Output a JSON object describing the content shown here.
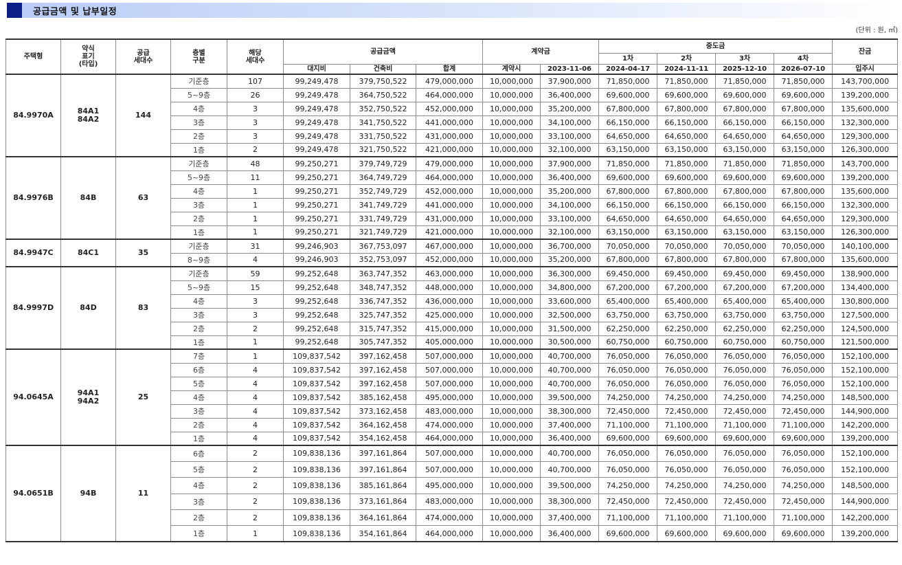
{
  "title": "공급금액 및 납부일정",
  "unit_note": "(단위 : 원, ㎡)",
  "headers": {
    "housing_type": "주택형",
    "abbrev": [
      "약식",
      "표기",
      "(타입)"
    ],
    "supply_units": [
      "공급",
      "세대수"
    ],
    "floor_group": [
      "층별",
      "구분"
    ],
    "applicable_units": [
      "해당",
      "세대수"
    ],
    "supply_amount": "공급금액",
    "land": "대지비",
    "building": "건축비",
    "total": "합계",
    "contract": "계약금",
    "contract_at": "계약시",
    "contract_date": "2023-11-06",
    "middle": "중도금",
    "mid1": "1차",
    "mid2": "2차",
    "mid3": "3차",
    "mid4": "4차",
    "mid1_date": "2024-04-17",
    "mid2_date": "2024-11-11",
    "mid3_date": "2025-12-10",
    "mid4_date": "2026-07-10",
    "balance": "잔금",
    "move_in": "입주시"
  },
  "groups": [
    {
      "type": "84.9970A",
      "abbrev": [
        "84A1",
        "84A2"
      ],
      "units": "144",
      "rows": [
        {
          "floor": "기준층",
          "count": "107",
          "land": "99,249,478",
          "building": "379,750,522",
          "total": "479,000,000",
          "c1": "10,000,000",
          "c2": "37,900,000",
          "m1": "71,850,000",
          "m2": "71,850,000",
          "m3": "71,850,000",
          "m4": "71,850,000",
          "bal": "143,700,000"
        },
        {
          "floor": "5~9층",
          "count": "26",
          "land": "99,249,478",
          "building": "364,750,522",
          "total": "464,000,000",
          "c1": "10,000,000",
          "c2": "36,400,000",
          "m1": "69,600,000",
          "m2": "69,600,000",
          "m3": "69,600,000",
          "m4": "69,600,000",
          "bal": "139,200,000"
        },
        {
          "floor": "4층",
          "count": "3",
          "land": "99,249,478",
          "building": "352,750,522",
          "total": "452,000,000",
          "c1": "10,000,000",
          "c2": "35,200,000",
          "m1": "67,800,000",
          "m2": "67,800,000",
          "m3": "67,800,000",
          "m4": "67,800,000",
          "bal": "135,600,000"
        },
        {
          "floor": "3층",
          "count": "3",
          "land": "99,249,478",
          "building": "341,750,522",
          "total": "441,000,000",
          "c1": "10,000,000",
          "c2": "34,100,000",
          "m1": "66,150,000",
          "m2": "66,150,000",
          "m3": "66,150,000",
          "m4": "66,150,000",
          "bal": "132,300,000"
        },
        {
          "floor": "2층",
          "count": "3",
          "land": "99,249,478",
          "building": "331,750,522",
          "total": "431,000,000",
          "c1": "10,000,000",
          "c2": "33,100,000",
          "m1": "64,650,000",
          "m2": "64,650,000",
          "m3": "64,650,000",
          "m4": "64,650,000",
          "bal": "129,300,000"
        },
        {
          "floor": "1층",
          "count": "2",
          "land": "99,249,478",
          "building": "321,750,522",
          "total": "421,000,000",
          "c1": "10,000,000",
          "c2": "32,100,000",
          "m1": "63,150,000",
          "m2": "63,150,000",
          "m3": "63,150,000",
          "m4": "63,150,000",
          "bal": "126,300,000"
        }
      ]
    },
    {
      "type": "84.9976B",
      "abbrev": [
        "84B"
      ],
      "units": "63",
      "rows": [
        {
          "floor": "기준층",
          "count": "48",
          "land": "99,250,271",
          "building": "379,749,729",
          "total": "479,000,000",
          "c1": "10,000,000",
          "c2": "37,900,000",
          "m1": "71,850,000",
          "m2": "71,850,000",
          "m3": "71,850,000",
          "m4": "71,850,000",
          "bal": "143,700,000"
        },
        {
          "floor": "5~9층",
          "count": "11",
          "land": "99,250,271",
          "building": "364,749,729",
          "total": "464,000,000",
          "c1": "10,000,000",
          "c2": "36,400,000",
          "m1": "69,600,000",
          "m2": "69,600,000",
          "m3": "69,600,000",
          "m4": "69,600,000",
          "bal": "139,200,000"
        },
        {
          "floor": "4층",
          "count": "1",
          "land": "99,250,271",
          "building": "352,749,729",
          "total": "452,000,000",
          "c1": "10,000,000",
          "c2": "35,200,000",
          "m1": "67,800,000",
          "m2": "67,800,000",
          "m3": "67,800,000",
          "m4": "67,800,000",
          "bal": "135,600,000"
        },
        {
          "floor": "3층",
          "count": "1",
          "land": "99,250,271",
          "building": "341,749,729",
          "total": "441,000,000",
          "c1": "10,000,000",
          "c2": "34,100,000",
          "m1": "66,150,000",
          "m2": "66,150,000",
          "m3": "66,150,000",
          "m4": "66,150,000",
          "bal": "132,300,000"
        },
        {
          "floor": "2층",
          "count": "1",
          "land": "99,250,271",
          "building": "331,749,729",
          "total": "431,000,000",
          "c1": "10,000,000",
          "c2": "33,100,000",
          "m1": "64,650,000",
          "m2": "64,650,000",
          "m3": "64,650,000",
          "m4": "64,650,000",
          "bal": "129,300,000"
        },
        {
          "floor": "1층",
          "count": "1",
          "land": "99,250,271",
          "building": "321,749,729",
          "total": "421,000,000",
          "c1": "10,000,000",
          "c2": "32,100,000",
          "m1": "63,150,000",
          "m2": "63,150,000",
          "m3": "63,150,000",
          "m4": "63,150,000",
          "bal": "126,300,000"
        }
      ]
    },
    {
      "type": "84.9947C",
      "abbrev": [
        "84C1"
      ],
      "units": "35",
      "rows": [
        {
          "floor": "기준층",
          "count": "31",
          "land": "99,246,903",
          "building": "367,753,097",
          "total": "467,000,000",
          "c1": "10,000,000",
          "c2": "36,700,000",
          "m1": "70,050,000",
          "m2": "70,050,000",
          "m3": "70,050,000",
          "m4": "70,050,000",
          "bal": "140,100,000"
        },
        {
          "floor": "8~9층",
          "count": "4",
          "land": "99,246,903",
          "building": "352,753,097",
          "total": "452,000,000",
          "c1": "10,000,000",
          "c2": "35,200,000",
          "m1": "67,800,000",
          "m2": "67,800,000",
          "m3": "67,800,000",
          "m4": "67,800,000",
          "bal": "135,600,000"
        }
      ]
    },
    {
      "type": "84.9997D",
      "abbrev": [
        "84D"
      ],
      "units": "83",
      "rows": [
        {
          "floor": "기준층",
          "count": "59",
          "land": "99,252,648",
          "building": "363,747,352",
          "total": "463,000,000",
          "c1": "10,000,000",
          "c2": "36,300,000",
          "m1": "69,450,000",
          "m2": "69,450,000",
          "m3": "69,450,000",
          "m4": "69,450,000",
          "bal": "138,900,000"
        },
        {
          "floor": "5~9층",
          "count": "15",
          "land": "99,252,648",
          "building": "348,747,352",
          "total": "448,000,000",
          "c1": "10,000,000",
          "c2": "34,800,000",
          "m1": "67,200,000",
          "m2": "67,200,000",
          "m3": "67,200,000",
          "m4": "67,200,000",
          "bal": "134,400,000"
        },
        {
          "floor": "4층",
          "count": "3",
          "land": "99,252,648",
          "building": "336,747,352",
          "total": "436,000,000",
          "c1": "10,000,000",
          "c2": "33,600,000",
          "m1": "65,400,000",
          "m2": "65,400,000",
          "m3": "65,400,000",
          "m4": "65,400,000",
          "bal": "130,800,000"
        },
        {
          "floor": "3층",
          "count": "3",
          "land": "99,252,648",
          "building": "325,747,352",
          "total": "425,000,000",
          "c1": "10,000,000",
          "c2": "32,500,000",
          "m1": "63,750,000",
          "m2": "63,750,000",
          "m3": "63,750,000",
          "m4": "63,750,000",
          "bal": "127,500,000"
        },
        {
          "floor": "2층",
          "count": "2",
          "land": "99,252,648",
          "building": "315,747,352",
          "total": "415,000,000",
          "c1": "10,000,000",
          "c2": "31,500,000",
          "m1": "62,250,000",
          "m2": "62,250,000",
          "m3": "62,250,000",
          "m4": "62,250,000",
          "bal": "124,500,000"
        },
        {
          "floor": "1층",
          "count": "1",
          "land": "99,252,648",
          "building": "305,747,352",
          "total": "405,000,000",
          "c1": "10,000,000",
          "c2": "30,500,000",
          "m1": "60,750,000",
          "m2": "60,750,000",
          "m3": "60,750,000",
          "m4": "60,750,000",
          "bal": "121,500,000"
        }
      ]
    },
    {
      "type": "94.0645A",
      "abbrev": [
        "94A1",
        "94A2"
      ],
      "units": "25",
      "rows": [
        {
          "floor": "7층",
          "count": "1",
          "land": "109,837,542",
          "building": "397,162,458",
          "total": "507,000,000",
          "c1": "10,000,000",
          "c2": "40,700,000",
          "m1": "76,050,000",
          "m2": "76,050,000",
          "m3": "76,050,000",
          "m4": "76,050,000",
          "bal": "152,100,000"
        },
        {
          "floor": "6층",
          "count": "4",
          "land": "109,837,542",
          "building": "397,162,458",
          "total": "507,000,000",
          "c1": "10,000,000",
          "c2": "40,700,000",
          "m1": "76,050,000",
          "m2": "76,050,000",
          "m3": "76,050,000",
          "m4": "76,050,000",
          "bal": "152,100,000"
        },
        {
          "floor": "5층",
          "count": "4",
          "land": "109,837,542",
          "building": "397,162,458",
          "total": "507,000,000",
          "c1": "10,000,000",
          "c2": "40,700,000",
          "m1": "76,050,000",
          "m2": "76,050,000",
          "m3": "76,050,000",
          "m4": "76,050,000",
          "bal": "152,100,000"
        },
        {
          "floor": "4층",
          "count": "4",
          "land": "109,837,542",
          "building": "385,162,458",
          "total": "495,000,000",
          "c1": "10,000,000",
          "c2": "39,500,000",
          "m1": "74,250,000",
          "m2": "74,250,000",
          "m3": "74,250,000",
          "m4": "74,250,000",
          "bal": "148,500,000"
        },
        {
          "floor": "3층",
          "count": "4",
          "land": "109,837,542",
          "building": "373,162,458",
          "total": "483,000,000",
          "c1": "10,000,000",
          "c2": "38,300,000",
          "m1": "72,450,000",
          "m2": "72,450,000",
          "m3": "72,450,000",
          "m4": "72,450,000",
          "bal": "144,900,000"
        },
        {
          "floor": "2층",
          "count": "4",
          "land": "109,837,542",
          "building": "364,162,458",
          "total": "474,000,000",
          "c1": "10,000,000",
          "c2": "37,400,000",
          "m1": "71,100,000",
          "m2": "71,100,000",
          "m3": "71,100,000",
          "m4": "71,100,000",
          "bal": "142,200,000"
        },
        {
          "floor": "1층",
          "count": "4",
          "land": "109,837,542",
          "building": "354,162,458",
          "total": "464,000,000",
          "c1": "10,000,000",
          "c2": "36,400,000",
          "m1": "69,600,000",
          "m2": "69,600,000",
          "m3": "69,600,000",
          "m4": "69,600,000",
          "bal": "139,200,000"
        }
      ]
    },
    {
      "type": "94.0651B",
      "abbrev": [
        "94B"
      ],
      "units": "11",
      "rows": [
        {
          "floor": "6층",
          "count": "2",
          "land": "109,838,136",
          "building": "397,161,864",
          "total": "507,000,000",
          "c1": "10,000,000",
          "c2": "40,700,000",
          "m1": "76,050,000",
          "m2": "76,050,000",
          "m3": "76,050,000",
          "m4": "76,050,000",
          "bal": "152,100,000"
        },
        {
          "floor": "5층",
          "count": "2",
          "land": "109,838,136",
          "building": "397,161,864",
          "total": "507,000,000",
          "c1": "10,000,000",
          "c2": "40,700,000",
          "m1": "76,050,000",
          "m2": "76,050,000",
          "m3": "76,050,000",
          "m4": "76,050,000",
          "bal": "152,100,000"
        },
        {
          "floor": "4층",
          "count": "2",
          "land": "109,838,136",
          "building": "385,161,864",
          "total": "495,000,000",
          "c1": "10,000,000",
          "c2": "39,500,000",
          "m1": "74,250,000",
          "m2": "74,250,000",
          "m3": "74,250,000",
          "m4": "74,250,000",
          "bal": "148,500,000"
        },
        {
          "floor": "3층",
          "count": "2",
          "land": "109,838,136",
          "building": "373,161,864",
          "total": "483,000,000",
          "c1": "10,000,000",
          "c2": "38,300,000",
          "m1": "72,450,000",
          "m2": "72,450,000",
          "m3": "72,450,000",
          "m4": "72,450,000",
          "bal": "144,900,000"
        },
        {
          "floor": "2층",
          "count": "2",
          "land": "109,838,136",
          "building": "364,161,864",
          "total": "474,000,000",
          "c1": "10,000,000",
          "c2": "37,400,000",
          "m1": "71,100,000",
          "m2": "71,100,000",
          "m3": "71,100,000",
          "m4": "71,100,000",
          "bal": "142,200,000"
        },
        {
          "floor": "1층",
          "count": "1",
          "land": "109,838,136",
          "building": "354,161,864",
          "total": "464,000,000",
          "c1": "10,000,000",
          "c2": "36,400,000",
          "m1": "69,600,000",
          "m2": "69,600,000",
          "m3": "69,600,000",
          "m4": "69,600,000",
          "bal": "139,200,000"
        }
      ]
    }
  ]
}
